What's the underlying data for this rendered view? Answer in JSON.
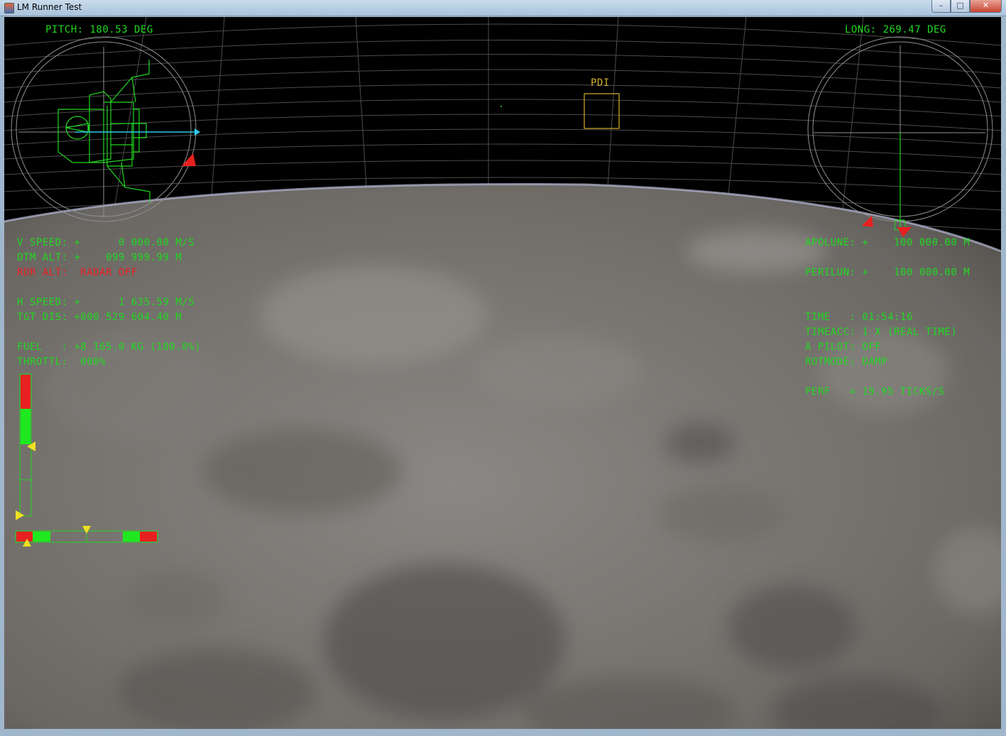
{
  "window": {
    "title": "LM Runner Test",
    "buttons": {
      "minimize": "–",
      "maximize": "□",
      "close": "✕"
    }
  },
  "hud": {
    "pitch": "PITCH: 180.53 DEG",
    "long": "LONG: 269.47 DEG",
    "target_label": "PDI",
    "left_readouts": [
      "V SPEED: +      0 000.00 M/S",
      "DTM ALT: +    099 999.99 M",
      "H SPEED: +      1 635.59 M/S",
      "TGT DIS: +000 529 604.40 M",
      "FUEL   : +8 165.0 KG (100.0%)",
      "THROTTL:  000%"
    ],
    "radar_alt": "RDR ALT:  RADAR OFF",
    "right_readouts": [
      "APOLUNE: +    100 000.00 M",
      "PERILUN: +    100 000.00 M",
      "TIME   : 01:54:16",
      "TIMEACC: 1 X (REAL TIME)",
      "A PILOT: OFF",
      "ROTMODE: DAMP",
      "PERF   = 19.95 TICKS/S"
    ]
  },
  "colors": {
    "hud_green": "#20d820",
    "warning_red": "#e82020",
    "target_gold": "#d8b030",
    "vector_cyan": "#30c8e8",
    "indicator_yellow": "#f0e020"
  },
  "throttle_level": 0.0,
  "fuel_level": 1.0
}
